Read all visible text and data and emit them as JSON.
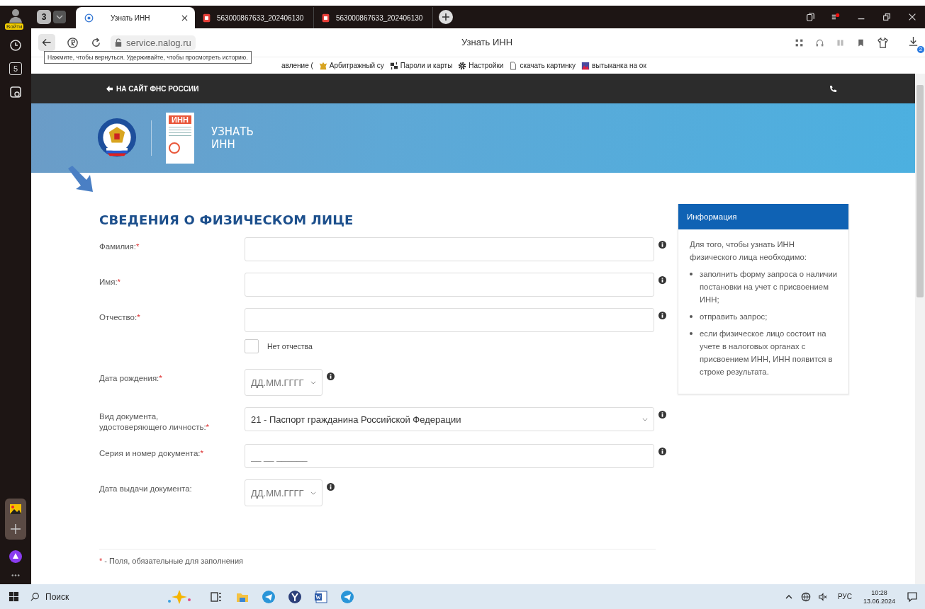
{
  "browser": {
    "account_badge": "Войти",
    "tab_count": "3",
    "tabs": [
      {
        "title": "Узнать ИНН",
        "selected": true,
        "kind": "site"
      },
      {
        "title": "563000867633_202406130",
        "selected": false,
        "kind": "pdf"
      },
      {
        "title": "563000867633_202406130",
        "selected": false,
        "kind": "pdf"
      }
    ],
    "address": "service.nalog.ru",
    "page_title": "Узнать ИНН",
    "downloads_badge": "2",
    "sidebar_badge": "5",
    "tooltip": "Нажмите, чтобы вернуться. Удерживайте, чтобы просмотреть историю.",
    "bookmarks": [
      {
        "label": "авление (",
        "kind": "page"
      },
      {
        "label": "Арбитражный су",
        "kind": "emblem"
      },
      {
        "label": "Пароли и карты",
        "kind": "keys"
      },
      {
        "label": "Настройки",
        "kind": "gear"
      },
      {
        "label": "скачать картинку",
        "kind": "page"
      },
      {
        "label": "вытыканка на ок",
        "kind": "image"
      }
    ]
  },
  "page": {
    "nav_link": "НА САЙТ ФНС РОССИИ",
    "logo_text": "ИНН",
    "banner_title": [
      "УЗНАТЬ",
      "ИНН"
    ],
    "form_title": "СВЕДЕНИЯ О ФИЗИЧЕСКОМ ЛИЦЕ",
    "required_mark": "*",
    "fields": [
      {
        "kind": "text",
        "label": "Фамилия:",
        "required": true
      },
      {
        "kind": "text",
        "label": "Имя:",
        "required": true
      },
      {
        "kind": "text",
        "label": "Отчество:",
        "required": true
      },
      {
        "kind": "checkbox",
        "label": "Нет отчества",
        "checked": false
      },
      {
        "kind": "date",
        "label": "Дата рождения:",
        "required": true,
        "placeholder": "ДД.ММ.ГГГГ"
      },
      {
        "kind": "select",
        "label": "Вид документа, удостоверяющего личность:",
        "required": true,
        "value": "21 - Паспорт гражданина Российской Федерации"
      },
      {
        "kind": "masked",
        "label": "Серия и номер документа:",
        "required": true,
        "placeholder": "__ __ ______"
      },
      {
        "kind": "date",
        "label": "Дата выдачи документа:",
        "required": false,
        "placeholder": "ДД.ММ.ГГГГ"
      }
    ],
    "footnote": " - Поля, обязательные для заполнения",
    "info": {
      "title": "Информация",
      "intro": "Для того, чтобы узнать ИНН физического лица необходимо:",
      "items": [
        "заполнить форму запроса о наличии постановки на учет с присвоением ИНН;",
        "отправить запрос;",
        "если физическое лицо состоит на учете в налоговых органах с присвоением ИНН, ИНН появится в строке результата."
      ]
    }
  },
  "taskbar": {
    "search_placeholder": "Поиск",
    "language": "РУС",
    "time": "10:28",
    "date": "13.06.2024"
  }
}
